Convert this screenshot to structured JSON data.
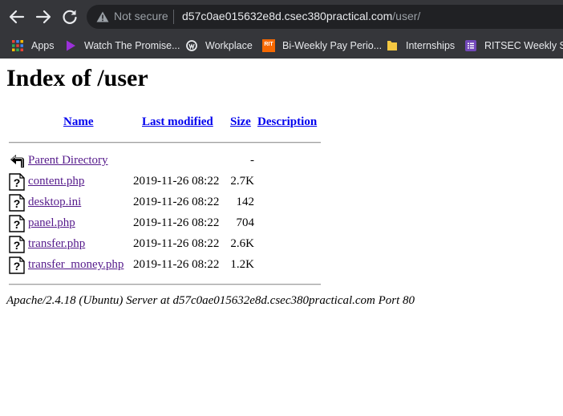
{
  "browser": {
    "security_label": "Not secure",
    "url_host": "d57c0ae015632e8d.csec380practical.com",
    "url_path": "/user/",
    "bookmarks": [
      {
        "label": "Apps",
        "icon": "apps-grid-icon"
      },
      {
        "label": "Watch The Promise...",
        "icon": "play-icon"
      },
      {
        "label": "Workplace",
        "icon": "workplace-icon"
      },
      {
        "label": "Bi-Weekly Pay Perio...",
        "icon": "rit-icon",
        "icon_text": "RIT"
      },
      {
        "label": "Internships",
        "icon": "folder-icon"
      },
      {
        "label": "RITSEC Weekly Sig",
        "icon": "form-icon"
      }
    ]
  },
  "page": {
    "title": "Index of /user",
    "columns": {
      "name": "Name",
      "modified": "Last modified",
      "size": "Size",
      "description": "Description"
    },
    "parent": {
      "name": "Parent Directory",
      "size": "-"
    },
    "files": [
      {
        "name": "content.php",
        "modified": "2019-11-26 08:22",
        "size": "2.7K"
      },
      {
        "name": "desktop.ini",
        "modified": "2019-11-26 08:22",
        "size": "142"
      },
      {
        "name": "panel.php",
        "modified": "2019-11-26 08:22",
        "size": "704"
      },
      {
        "name": "transfer.php",
        "modified": "2019-11-26 08:22",
        "size": "2.6K"
      },
      {
        "name": "transfer_money.php",
        "modified": "2019-11-26 08:22",
        "size": "1.2K"
      }
    ],
    "server_signature": "Apache/2.4.18 (Ubuntu) Server at d57c0ae015632e8d.csec380practical.com Port 80"
  }
}
